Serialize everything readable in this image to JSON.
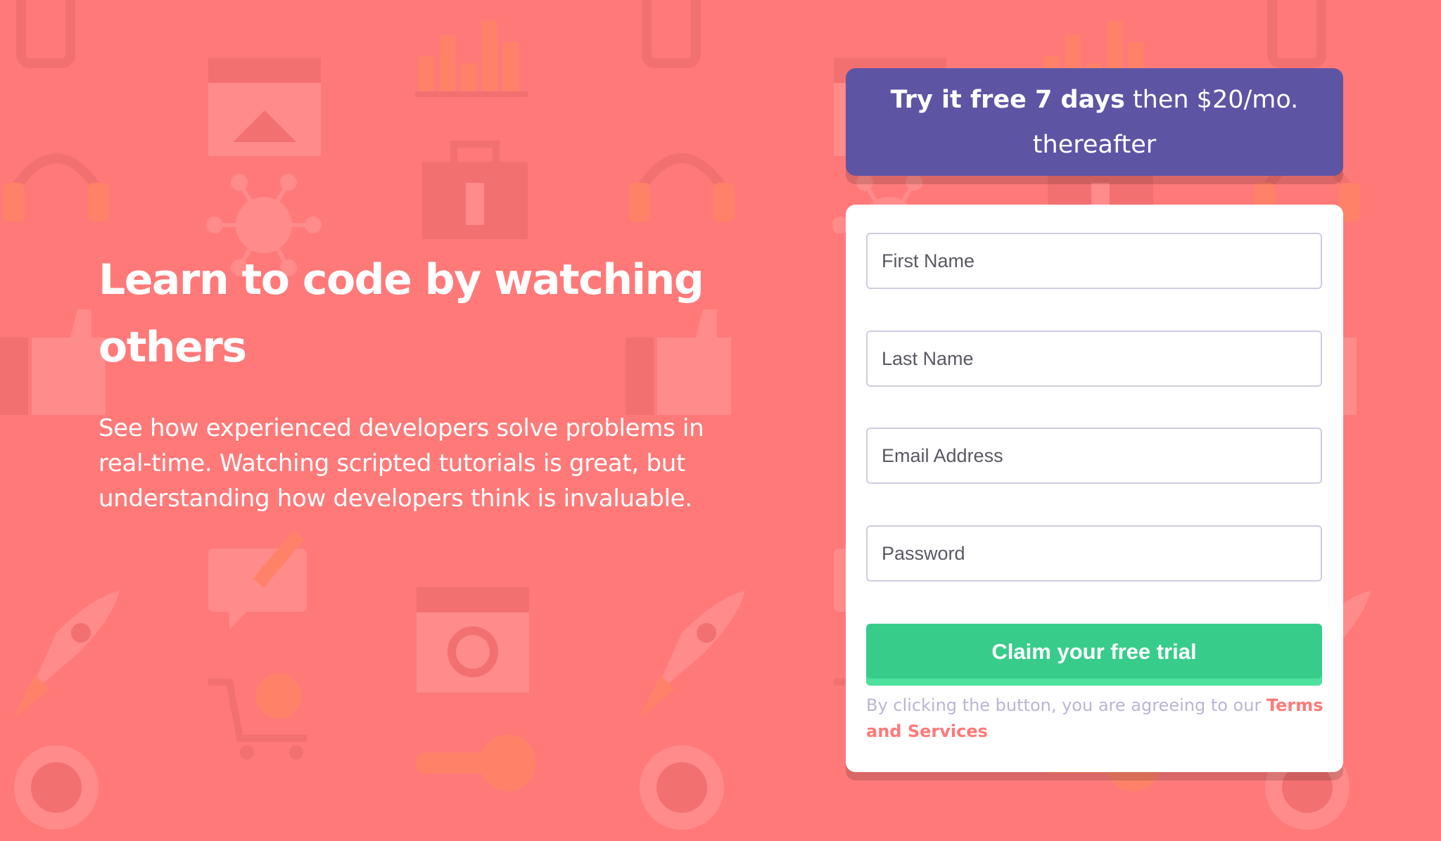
{
  "hero": {
    "title": "Learn to code by watching others",
    "description": "See how experienced developers solve problems in real-time. Watching scripted tutorials is great, but understanding how developers think is invaluable."
  },
  "promo": {
    "bold": "Try it free 7 days",
    "rest": " then $20/mo. thereafter"
  },
  "form": {
    "first_name_placeholder": "First Name",
    "last_name_placeholder": "Last Name",
    "email_placeholder": "Email Address",
    "password_placeholder": "Password",
    "submit_label": "Claim your free trial",
    "terms_prefix": "By clicking the button, you are agreeing to our ",
    "terms_link": "Terms and Services"
  },
  "colors": {
    "background": "#ff7979",
    "promo": "#5e54a4",
    "button": "#38cc8b",
    "button_highlight": "#4ee09d",
    "terms_text": "#b9b6d3",
    "terms_link": "#ff7979"
  },
  "background_icons": [
    "browser-window-icon",
    "bar-chart-icon",
    "headset-icon",
    "network-icon",
    "thumbs-up-icon",
    "chat-edit-icon",
    "rocket-icon",
    "cart-icon",
    "globe-gear-icon",
    "key-icon",
    "wrench-toolbox-icon",
    "phone-icon"
  ]
}
